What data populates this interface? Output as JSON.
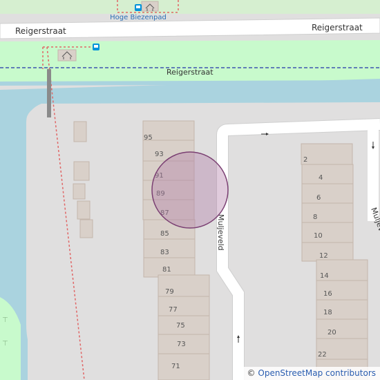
{
  "map": {
    "streets": {
      "reigerstraat_left": "Reigerstraat",
      "reigerstraat_right": "Reigerstraat",
      "reigerstraat_path": "Reigerstraat",
      "mulje_main": "Muljeveld",
      "mulje_right": "Muljeveld"
    },
    "stop_name": "Hoge Biezenpad",
    "colors": {
      "water": "#aad3df",
      "grass": "#c8facc",
      "building": "#d9d0c9",
      "building_stroke": "#c4b6ab",
      "road": "#ffffff",
      "marker_fill": "#b27ca8",
      "marker_stroke": "#7a3f72",
      "bus_stop": "#0092da"
    },
    "house_numbers_left": [
      "95",
      "93",
      "91",
      "89",
      "87",
      "85",
      "83",
      "81",
      "79",
      "77",
      "75",
      "73",
      "71"
    ],
    "house_numbers_right": [
      "2",
      "4",
      "6",
      "8",
      "10",
      "12",
      "14",
      "16",
      "18",
      "20",
      "22"
    ]
  },
  "attribution": {
    "symbol": "©",
    "text": "OpenStreetMap contributors"
  }
}
